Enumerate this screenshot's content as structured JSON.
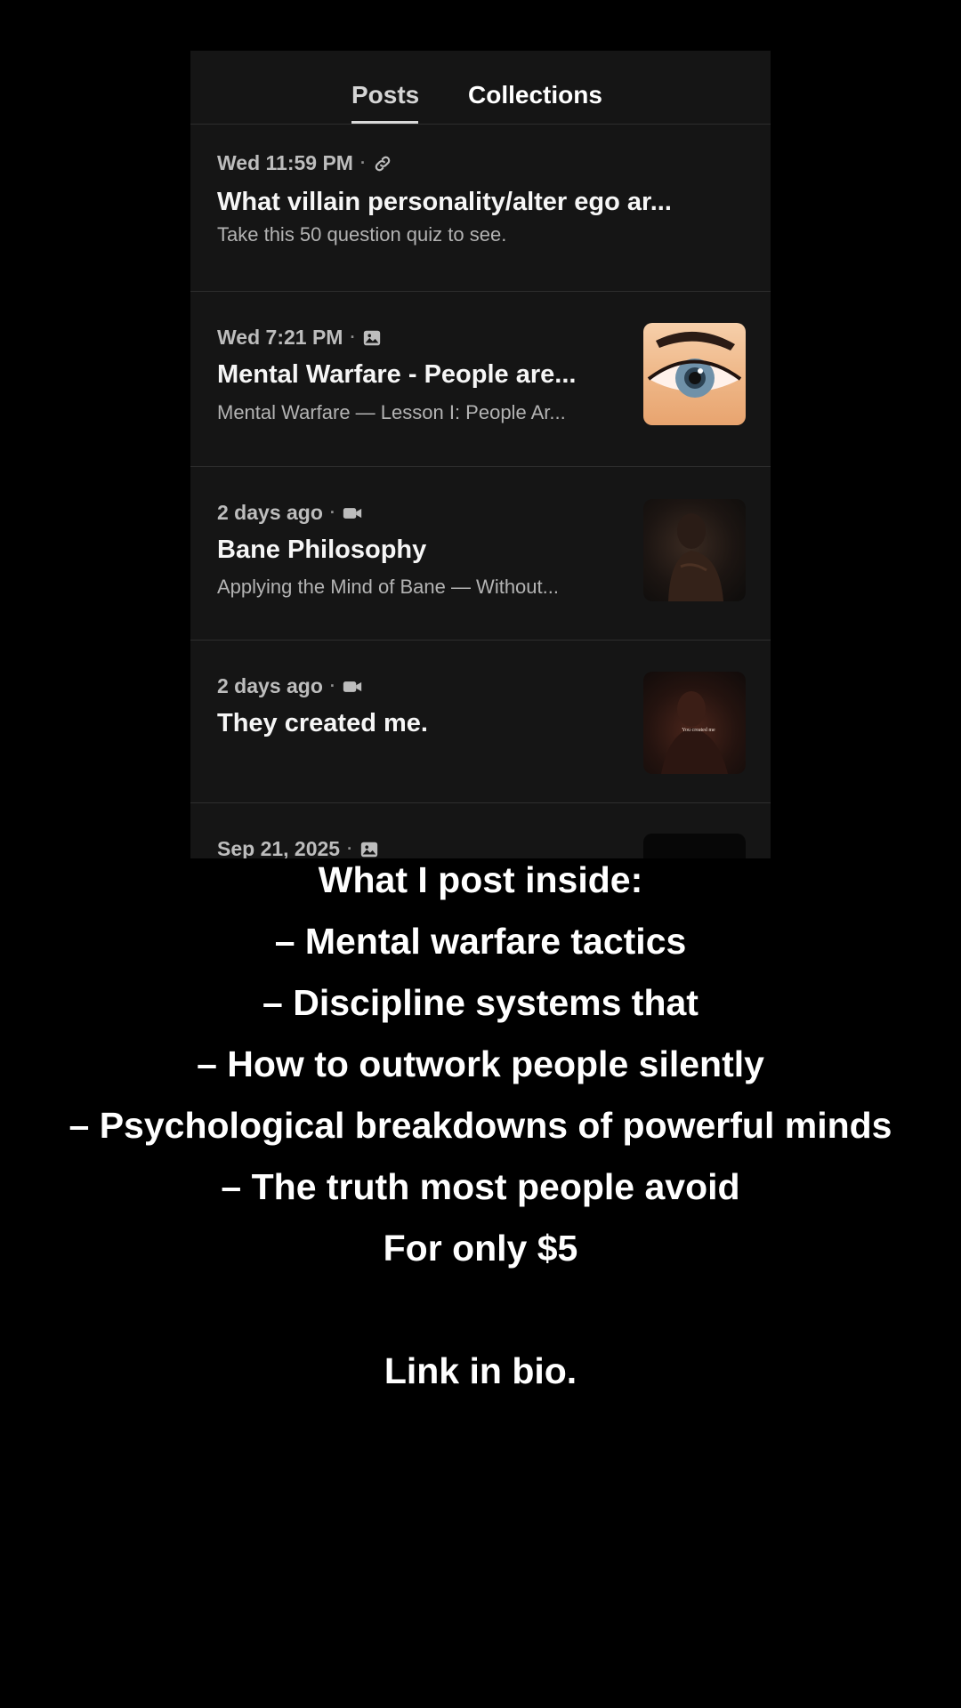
{
  "tabs": [
    {
      "label": "Posts",
      "active": true
    },
    {
      "label": "Collections",
      "active": false
    }
  ],
  "posts": [
    {
      "meta_time": "Wed 11:59 PM",
      "type_icon": "link-icon",
      "title": "What villain personality/alter ego ar...",
      "excerpt": "Take this 50 question quiz to see."
    },
    {
      "meta_time": "Wed 7:21 PM",
      "type_icon": "image-icon",
      "title": "Mental Warfare - People are...",
      "excerpt": "Mental Warfare — Lesson I: People Ar...",
      "thumbnail": "eye-closeup"
    },
    {
      "meta_time": "2 days ago",
      "type_icon": "video-icon",
      "title": "Bane Philosophy",
      "excerpt": "Applying the Mind of Bane — Without...",
      "thumbnail": "dark-portrait"
    },
    {
      "meta_time": "2 days ago",
      "type_icon": "video-icon",
      "title": "They created me.",
      "thumbnail": "dark-portrait-with-text",
      "thumbnail_text": "You created me"
    },
    {
      "meta_time": "Sep 21, 2025",
      "type_icon": "image-icon",
      "thumbnail": "dark-square"
    }
  ],
  "promo": {
    "lines": [
      "What I post inside:",
      "– Mental warfare tactics",
      "– Discipline systems that",
      "– How to outwork people silently",
      "– Psychological breakdowns of powerful minds",
      "– The truth most people avoid",
      "For only $5",
      "Link in bio."
    ]
  },
  "colors": {
    "background": "#000000",
    "panel": "#151515",
    "divider": "#2e2e2e",
    "text_primary": "#f6f6f6",
    "text_secondary": "#b3b3b3"
  }
}
